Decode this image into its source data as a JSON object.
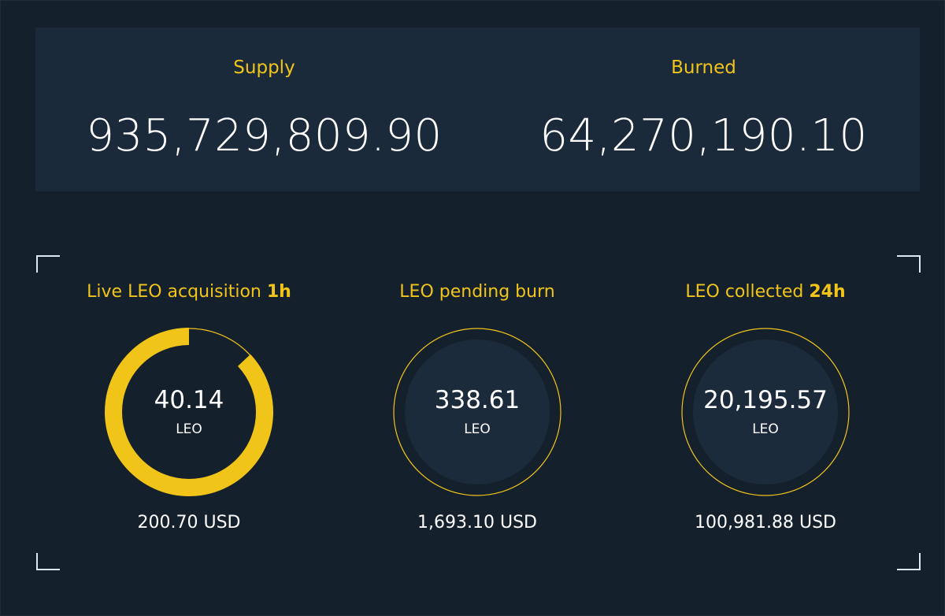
{
  "supply": {
    "label": "Supply",
    "value": "935,729,809.90"
  },
  "burned": {
    "label": "Burned",
    "value": "64,270,190.10"
  },
  "metrics": [
    {
      "title_prefix": "Live LEO acquisition ",
      "title_bold": "1h",
      "value": "40.14",
      "unit": "LEO",
      "usd": "200.70 USD",
      "progress": 0.87
    },
    {
      "title_prefix": "LEO pending burn",
      "title_bold": "",
      "value": "338.61",
      "unit": "LEO",
      "usd": "1,693.10 USD"
    },
    {
      "title_prefix": "LEO collected ",
      "title_bold": "24h",
      "value": "20,195.57",
      "unit": "LEO",
      "usd": "100,981.88 USD"
    }
  ],
  "colors": {
    "accent": "#f0c419",
    "background": "#15202d",
    "panel": "#1a2a3b",
    "inner_circle": "#1b2b3c"
  }
}
